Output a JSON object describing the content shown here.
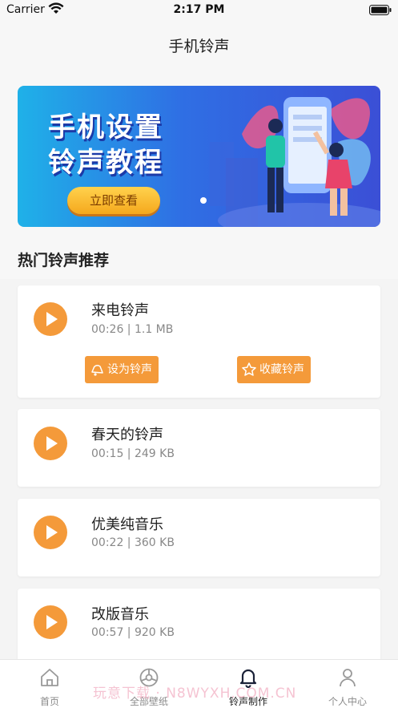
{
  "status_bar": {
    "carrier": "Carrier",
    "time": "2:17 PM"
  },
  "nav": {
    "title": "手机铃声"
  },
  "banner": {
    "title_line1": "手机设置",
    "title_line2": "铃声教程",
    "button_label": "立即查看"
  },
  "section": {
    "title": "热门铃声推荐"
  },
  "ringtones": [
    {
      "name": "来电铃声",
      "meta": "00:26 | 1.1 MB",
      "set_label": "设为铃声",
      "fav_label": "收藏铃声"
    },
    {
      "name": "春天的铃声",
      "meta": "00:15 | 249 KB"
    },
    {
      "name": "优美纯音乐",
      "meta": "00:22 | 360 KB"
    },
    {
      "name": "改版音乐",
      "meta": "00:57 | 920 KB"
    }
  ],
  "tabs": [
    {
      "label": "首页",
      "icon": "home-icon"
    },
    {
      "label": "全部壁纸",
      "icon": "wheel-icon"
    },
    {
      "label": "铃声制作",
      "icon": "bell-icon",
      "active": true
    },
    {
      "label": "个人中心",
      "icon": "person-icon"
    }
  ],
  "watermark": "玩意下载 · N8WYXH.COM.CN",
  "colors": {
    "accent": "#f49a3a",
    "banner_start": "#1fb1e8",
    "banner_end": "#3b4fd6"
  }
}
